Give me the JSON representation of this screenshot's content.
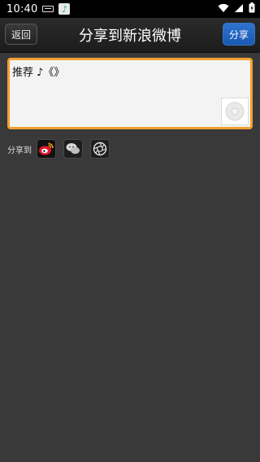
{
  "status_bar": {
    "time": "10:40"
  },
  "header": {
    "back_label": "返回",
    "title": "分享到新浪微博",
    "share_label": "分享"
  },
  "compose": {
    "text": "推荐 ♪《》"
  },
  "share_targets": {
    "label": "分享到",
    "items": [
      {
        "name": "weibo",
        "icon": "weibo-icon",
        "selected": true
      },
      {
        "name": "wechat",
        "icon": "wechat-icon",
        "selected": false
      },
      {
        "name": "moments",
        "icon": "moments-icon",
        "selected": false
      }
    ]
  },
  "colors": {
    "accent_orange": "#f2a031",
    "share_button_blue": "#1f63bd",
    "background": "#393939"
  }
}
